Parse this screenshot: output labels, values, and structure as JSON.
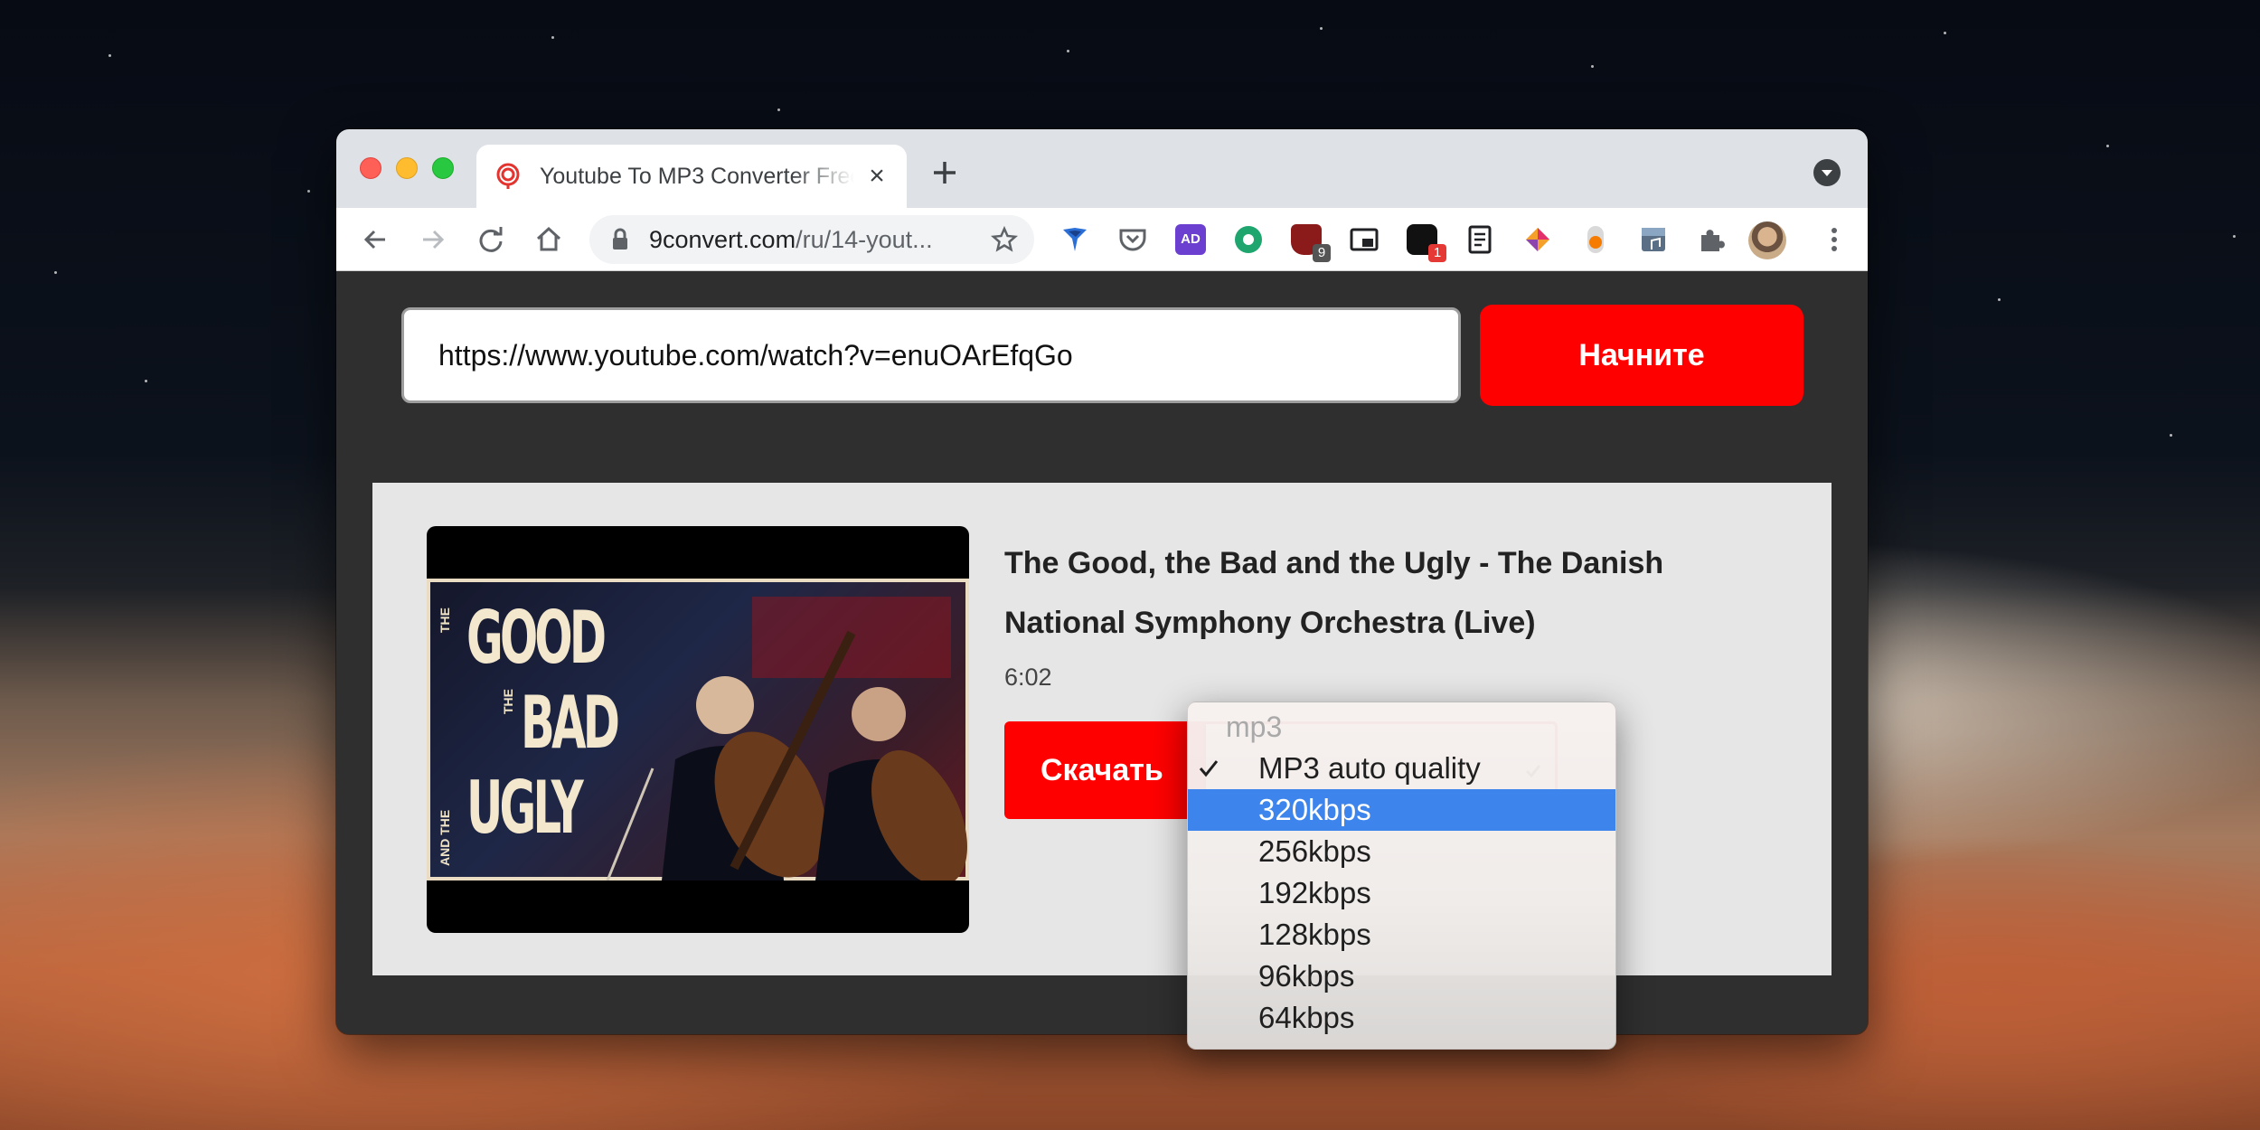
{
  "browser": {
    "tab": {
      "title": "Youtube To MP3 Converter Free",
      "close_symbol": "×"
    },
    "new_tab_symbol": "+",
    "omnibox": {
      "host": "9convert.com",
      "path": "/ru/14-yout..."
    },
    "extensions": [
      {
        "name": "adguard-icon"
      },
      {
        "name": "pocket-icon"
      },
      {
        "name": "ad-icon",
        "label": "AD"
      },
      {
        "name": "green-extension-icon"
      },
      {
        "name": "ublock-icon",
        "badge": "9"
      },
      {
        "name": "picture-in-picture-icon"
      },
      {
        "name": "messenger-extension-icon",
        "badge": "1"
      },
      {
        "name": "reader-icon"
      },
      {
        "name": "colorful-extension-icon"
      },
      {
        "name": "orange-extension-icon"
      },
      {
        "name": "music-extension-icon"
      },
      {
        "name": "extensions-puzzle-icon"
      }
    ]
  },
  "converter": {
    "url_value": "https://www.youtube.com/watch?v=enuOArEfqGo",
    "start_label": "Начните",
    "download_label": "Скачать"
  },
  "video": {
    "title": "The Good, the Bad and the Ugly - The Danish National Symphony Orchestra (Live)",
    "duration": "6:02",
    "thumbnail": {
      "lines": [
        "GOOD",
        "BAD",
        "UGLY"
      ],
      "small_words": [
        "THE",
        "THE",
        "AND THE"
      ]
    }
  },
  "format_dropdown": {
    "group_label": "mp3",
    "checked_option": "MP3 auto quality",
    "highlighted_option": "320kbps",
    "options": [
      "MP3 auto quality",
      "320kbps",
      "256kbps",
      "192kbps",
      "128kbps",
      "96kbps",
      "64kbps"
    ]
  },
  "colors": {
    "accent_red": "#ff0000",
    "highlight_blue": "#3d85ec",
    "page_bg": "#2f2f2f",
    "card_bg": "#e6e6e6"
  }
}
